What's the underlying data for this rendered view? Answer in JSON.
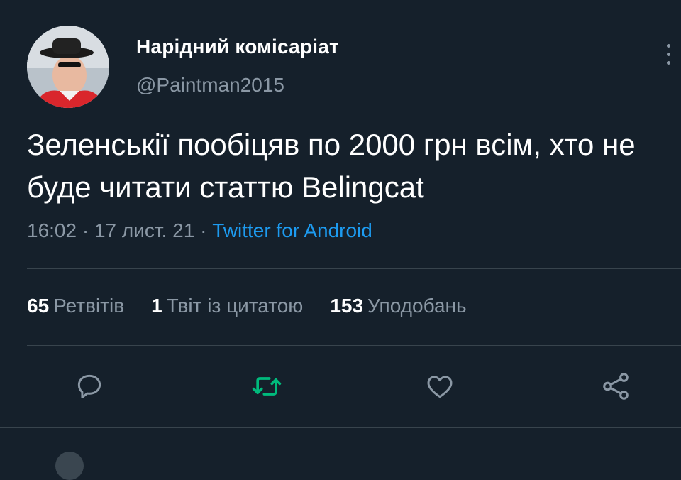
{
  "author": {
    "display_name": "Нарідний комісаріат",
    "handle": "@Paintman2015"
  },
  "tweet": {
    "text": "Зеленськії пообіцяв по 2000 грн всім, хто не буде читати статтю Belingcat",
    "time": "16:02",
    "separator": "·",
    "date": "17 лист. 21",
    "source": "Twitter for Android"
  },
  "stats": {
    "retweets_count": "65",
    "retweets_label": "Ретвітів",
    "quotes_count": "1",
    "quotes_label": "Твіт із цитатою",
    "likes_count": "153",
    "likes_label": "Уподобань"
  },
  "colors": {
    "background": "#15202b",
    "secondary_text": "#8b98a5",
    "link": "#1d9bf0",
    "retweet_active": "#00ba7c",
    "divider": "#38444d"
  },
  "actions": {
    "reply_icon": "reply-icon",
    "retweet_icon": "retweet-icon",
    "like_icon": "heart-icon",
    "share_icon": "share-icon"
  }
}
